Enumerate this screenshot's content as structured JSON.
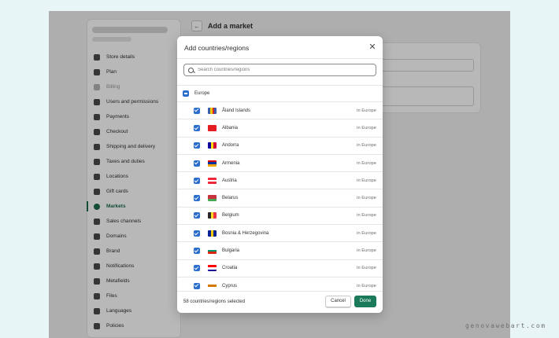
{
  "nav": {
    "items": [
      {
        "label": "Store details",
        "icon": "store-icon"
      },
      {
        "label": "Plan",
        "icon": "plan-icon"
      },
      {
        "label": "Billing",
        "icon": "billing-icon"
      },
      {
        "label": "Users and permissions",
        "icon": "user-icon"
      },
      {
        "label": "Payments",
        "icon": "payments-icon"
      },
      {
        "label": "Checkout",
        "icon": "cart-icon"
      },
      {
        "label": "Shipping and delivery",
        "icon": "truck-icon"
      },
      {
        "label": "Taxes and duties",
        "icon": "taxes-icon"
      },
      {
        "label": "Locations",
        "icon": "location-pin-icon"
      },
      {
        "label": "Gift cards",
        "icon": "gift-card-icon"
      },
      {
        "label": "Markets",
        "icon": "globe-icon"
      },
      {
        "label": "Sales channels",
        "icon": "sales-channels-icon"
      },
      {
        "label": "Domains",
        "icon": "domains-icon"
      },
      {
        "label": "Brand",
        "icon": "brand-icon"
      },
      {
        "label": "Notifications",
        "icon": "bell-icon"
      },
      {
        "label": "Metafields",
        "icon": "metafields-icon"
      },
      {
        "label": "Files",
        "icon": "paperclip-icon"
      },
      {
        "label": "Languages",
        "icon": "language-icon"
      },
      {
        "label": "Policies",
        "icon": "policies-icon"
      }
    ],
    "active": "Markets",
    "muted": "Billing"
  },
  "page": {
    "title": "Add a market",
    "back_icon": "arrow-left-icon"
  },
  "modal": {
    "title": "Add countries/regions",
    "close_icon": "close-icon",
    "search_placeholder": "Search countries/regions",
    "group_label": "Europe",
    "countries": [
      {
        "name": "Åland Islands",
        "region": "in Europe",
        "checked": true
      },
      {
        "name": "Albania",
        "region": "in Europe",
        "checked": true
      },
      {
        "name": "Andorra",
        "region": "in Europe",
        "checked": true
      },
      {
        "name": "Armenia",
        "region": "in Europe",
        "checked": true
      },
      {
        "name": "Austria",
        "region": "in Europe",
        "checked": true
      },
      {
        "name": "Belarus",
        "region": "in Europe",
        "checked": true
      },
      {
        "name": "Belgium",
        "region": "in Europe",
        "checked": true
      },
      {
        "name": "Bosnia & Herzegovina",
        "region": "in Europe",
        "checked": true
      },
      {
        "name": "Bulgaria",
        "region": "in Europe",
        "checked": true
      },
      {
        "name": "Croatia",
        "region": "in Europe",
        "checked": true
      },
      {
        "name": "Cyprus",
        "region": "in Europe",
        "checked": true
      }
    ],
    "selected_count_text": "58 countries/regions selected",
    "cancel_label": "Cancel",
    "done_label": "Done"
  },
  "colors": {
    "primary_green": "#1a7a5a",
    "checkbox_blue": "#2c6ecb",
    "page_background": "#e7f5f6"
  },
  "watermark": "genovawebart.com"
}
